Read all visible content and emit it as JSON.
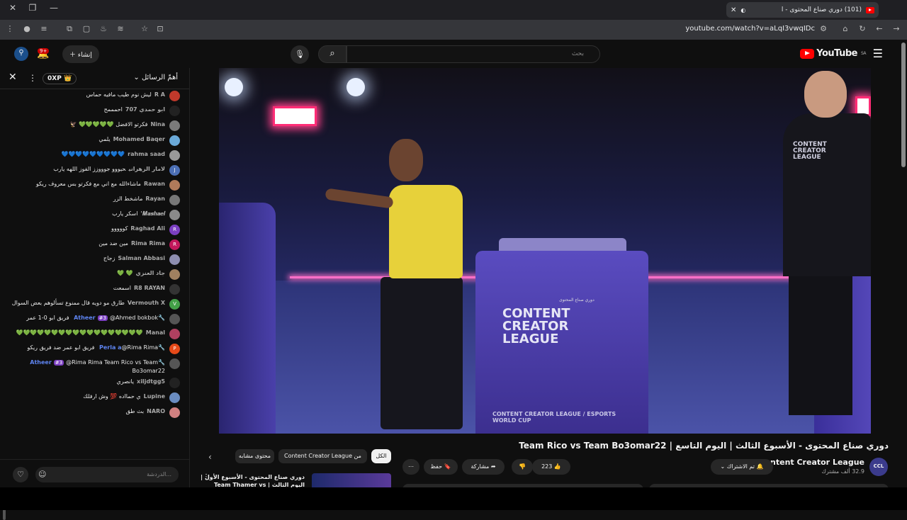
{
  "browser": {
    "tab_title": "(101) دوري صناع المحتوى - ا",
    "url": "youtube.com/watch?v=aLqI3vwqIDc",
    "icons": [
      "close-icon",
      "maximize-icon",
      "minimize-icon",
      "new-tab-icon",
      "reload-icon",
      "back-icon",
      "forward-icon",
      "home-icon",
      "star-icon"
    ]
  },
  "yt_header": {
    "logo_text": "YouTube",
    "logo_region": "SA",
    "search_placeholder": "بحث",
    "create_label": "إنشاء",
    "notif_count": "9+"
  },
  "chat": {
    "title": "أهمّ الرسائل",
    "xp": "0XP",
    "input_placeholder": "الدردشة...",
    "messages": [
      {
        "author": "R A",
        "text": "ليش نوم طيب مافيه حماس",
        "avatar": "",
        "color": "#c0392b"
      },
      {
        "author": "ابو حمدي 707",
        "text": "احمممح",
        "avatar": "",
        "color": "#222"
      },
      {
        "author": "Nina",
        "text": "فكرتو الافضل 💚💚💚💚💚 🦅",
        "avatar": "",
        "color": "#7a7a7a"
      },
      {
        "author": "Mohamed Baqer",
        "text": "يلمي",
        "avatar": "",
        "color": "#6aa9d8"
      },
      {
        "author": "rahma saad",
        "text": "💙💙💙💙💙💙💙💙💙",
        "avatar": "",
        "color": "#999"
      },
      {
        "author": "لامار الزهراني",
        "text": "حيووو جوووزز الفوز اللهه يارب",
        "avatar": "J",
        "color": "#4c6fb5"
      },
      {
        "author": "Rawan",
        "text": "ماشاءالله مع اني مع فكرتو بس معروف ريكو",
        "avatar": "",
        "color": "#b07a5a"
      },
      {
        "author": "Rayan",
        "text": "ماشخط الزر",
        "avatar": "",
        "color": "#777"
      },
      {
        "author": "𝑴𝒂𝒔𝒉𝒂𝒆𝒍'",
        "text": "اسكر يارب",
        "avatar": "",
        "color": "#8a8a8a"
      },
      {
        "author": "Raghad Ali",
        "text": "كووووو",
        "avatar": "R",
        "color": "#7b3fc1"
      },
      {
        "author": "Rima Rima",
        "text": "مين ضد مين",
        "avatar": "R",
        "color": "#c2185b"
      },
      {
        "author": "Salman Abbasi",
        "text": "زجاج",
        "avatar": "",
        "color": "#8e8eb0"
      },
      {
        "author": "جاد العنزي",
        "text": "💚 💚",
        "avatar": "",
        "color": "#a08060"
      },
      {
        "author": "R8 RAYAN",
        "text": "اسمعت",
        "avatar": "",
        "color": "#333"
      },
      {
        "author": "Vermouth X",
        "text": "طارق مو دويه قال ممنوع تسألوهم بعض السوال",
        "avatar": "V",
        "color": "#43a047"
      },
      {
        "author": "Atheer",
        "text": "@Ahmed bokbok فريق ابو 0-1 عمر",
        "avatar": "",
        "color": "#555",
        "mod": true,
        "rank": "#3"
      },
      {
        "author": "Manal",
        "text": "💚💚💚💚💚💚💚💚💚💚💚💚💚💚💚💚💚💚",
        "avatar": "",
        "color": "#b04060"
      },
      {
        "author": "Perla a",
        "text": "@Rima Rima فريق ابو عمر ضد فريق ريكو",
        "avatar": "P",
        "color": "#e64a19",
        "mod": true
      },
      {
        "author": "Atheer",
        "text": "@Rima Rima Team Rico vs Team Bo3omar22",
        "avatar": "",
        "color": "#555",
        "mod": true,
        "rank": "#3"
      },
      {
        "author": "xiljdtgg5",
        "text": "يانصري",
        "avatar": "",
        "color": "#222"
      },
      {
        "author": "Lupine",
        "text": "ي حمااده 💯 وش ارفلك",
        "avatar": "",
        "color": "#6a8cc0"
      },
      {
        "author": "NARO",
        "text": "بث طق",
        "avatar": "",
        "color": "#d08080"
      }
    ]
  },
  "video": {
    "stage_text": "CONTENT CREATOR LEAGUE",
    "stage_small": "دوري صناع المحتوى",
    "ewc_text": "CONTENT CREATOR LEAGUE / ESPORTS WORLD CUP",
    "shirt_logo": "CONTENT CREATOR LEAGUE"
  },
  "below": {
    "title": "دوري صناع المحتوى - الأسبوع الثالث | اليوم التاسع | Team Rico vs Team Bo3omar22",
    "channel": "Content Creator League",
    "subscribers": "32.9 ألف مشترك",
    "subscribed_label": "تم الاشتراك",
    "likes": "223",
    "share_label": "مشاركة",
    "save_label": "حفظ",
    "chips": [
      "الكل",
      "من Content Creator League",
      "محتوى مشابه"
    ],
    "rec_title": "دوري صناع المحتوى - الأسبوع الأول | اليوم الثالث | Team Thamer vs Team"
  }
}
